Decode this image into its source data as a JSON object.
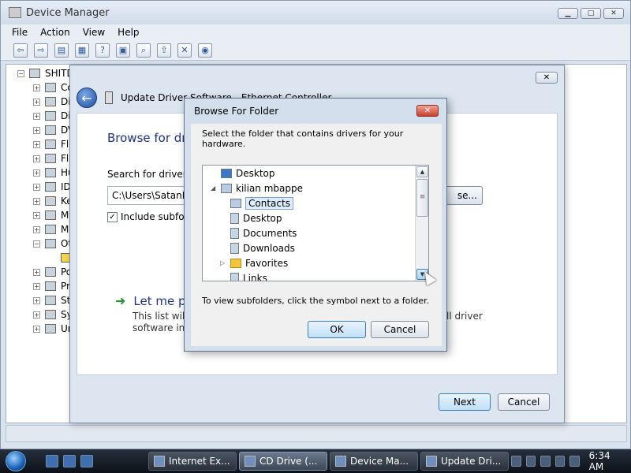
{
  "device_manager": {
    "title": "Device Manager",
    "menu": [
      "File",
      "Action",
      "View",
      "Help"
    ],
    "root_node": "SHITD",
    "tree_items": [
      "Co",
      "Di",
      "Di",
      "DV",
      "Flo",
      "Flo",
      "Hu",
      "ID",
      "Ke",
      "M",
      "M",
      "Ot",
      "",
      "Po",
      "Pr",
      "St",
      "Sy",
      "Ur"
    ]
  },
  "wizard": {
    "title": "Update Driver Software - Ethernet Controller",
    "heading": "Browse for dri",
    "search_label": "Search for driver so",
    "path_value": "C:\\Users\\SatanNa",
    "browse_label": "se...",
    "include_subfolders_label": "Include subfold",
    "pick_label": "Let me pi",
    "pick_desc_line1": "This list will s",
    "pick_desc_line2": "software in t",
    "pick_desc_right": "ll driver",
    "next_label": "Next",
    "cancel_label": "Cancel"
  },
  "browse_dialog": {
    "title": "Browse For Folder",
    "description": "Select the folder that contains drivers for your hardware.",
    "tree": [
      {
        "label": "Desktop",
        "icon": "desktop-icon"
      },
      {
        "label": "kilian mbappe",
        "icon": "user-folder-icon"
      },
      {
        "label": "Contacts",
        "icon": "contacts-folder-icon"
      },
      {
        "label": "Desktop",
        "icon": "folder-icon"
      },
      {
        "label": "Documents",
        "icon": "folder-icon"
      },
      {
        "label": "Downloads",
        "icon": "folder-icon"
      },
      {
        "label": "Favorites",
        "icon": "favorites-star-icon"
      },
      {
        "label": "Links",
        "icon": "folder-icon"
      }
    ],
    "hint": "To view subfolders, click the symbol next to a folder.",
    "ok_label": "OK",
    "cancel_label": "Cancel"
  },
  "taskbar": {
    "tasks": [
      {
        "label": "Internet Ex...",
        "active": false
      },
      {
        "label": "CD Drive (...",
        "active": true
      },
      {
        "label": "Device Ma...",
        "active": false
      },
      {
        "label": "Update Dri...",
        "active": false
      }
    ],
    "time": "6:34 AM"
  }
}
